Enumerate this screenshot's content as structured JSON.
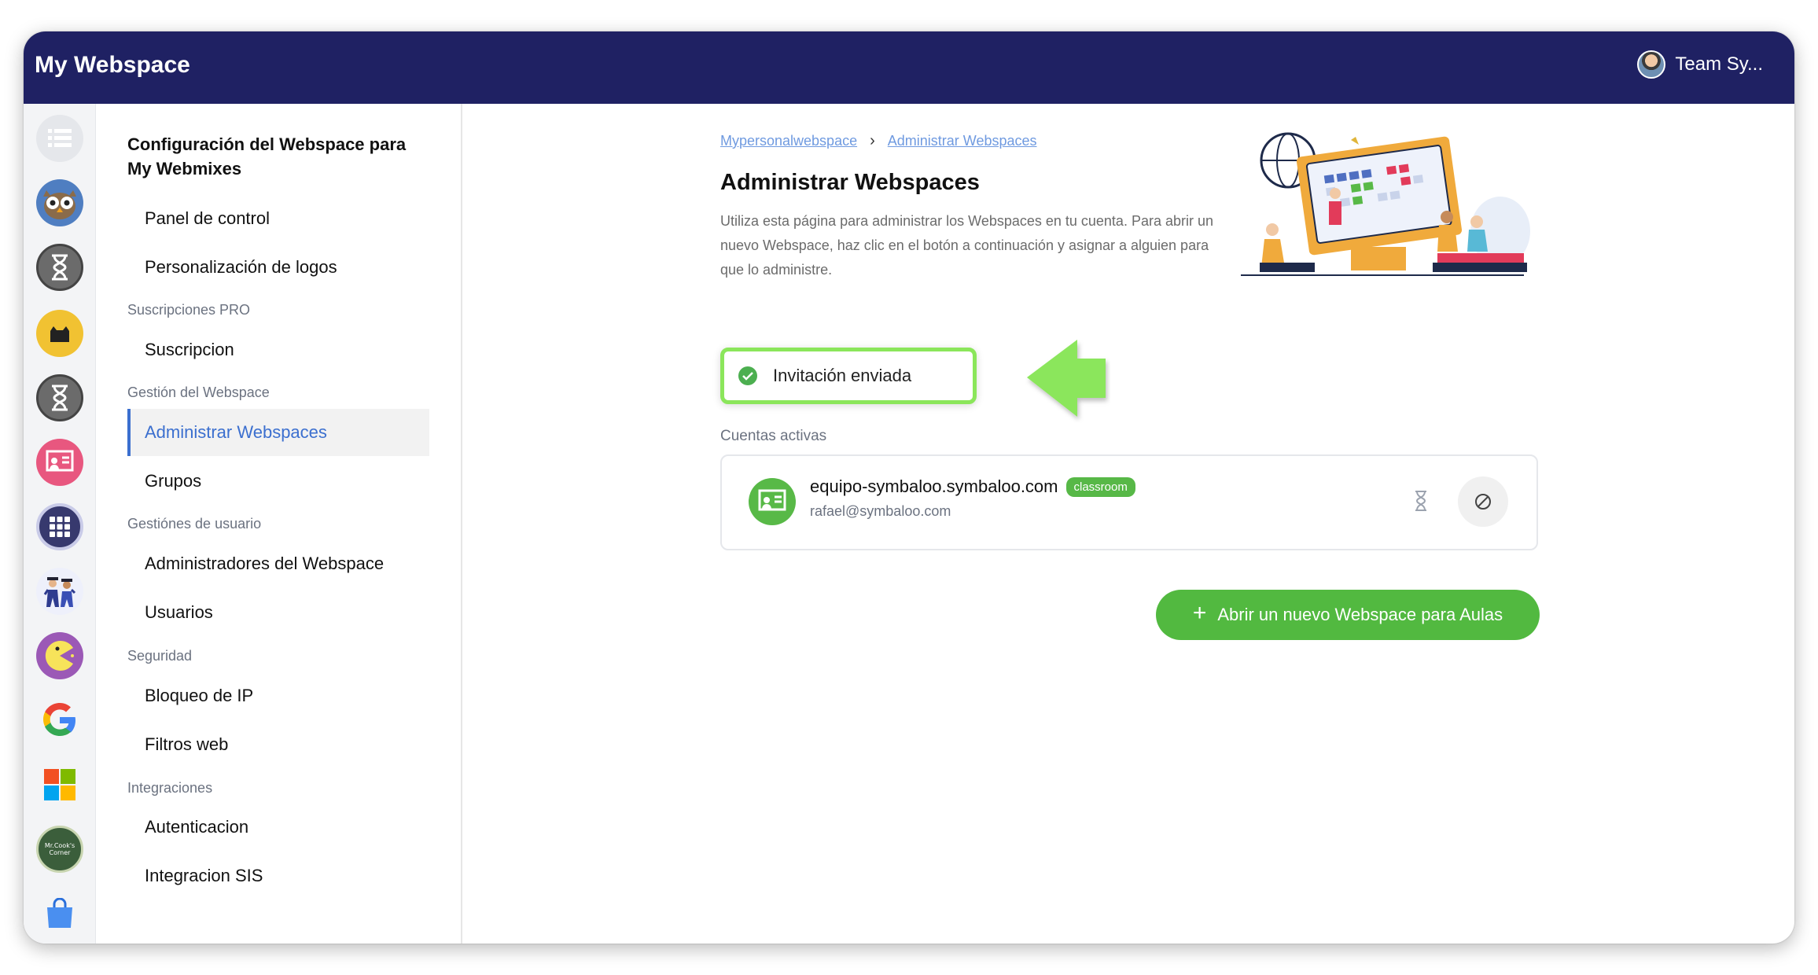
{
  "app": {
    "title": "My Webspace",
    "team_label": "Team Sy..."
  },
  "iconbar": {
    "items": [
      "list-icon",
      "owl-icon",
      "hourglass-icon",
      "cat-icon",
      "hourglass-icon",
      "classroom-icon",
      "apps-grid-icon",
      "graduates-icon",
      "pacman-icon",
      "google-icon",
      "windows-icon",
      "mr-cooks-corner-icon",
      "shopping-bag-icon"
    ],
    "mr_cook_text": "Mr.Cook's Corner"
  },
  "sidebar": {
    "title": "Configuración del Webspace para My Webmixes",
    "items": {
      "panel": "Panel de control",
      "logos": "Personalización de logos",
      "sec_pro": "Suscripciones PRO",
      "suscripcion": "Suscripcion",
      "sec_gestion": "Gestión del Webspace",
      "administrar": "Administrar Webspaces",
      "grupos": "Grupos",
      "sec_usuario": "Gestiónes de usuario",
      "admins": "Administradores del Webspace",
      "usuarios": "Usuarios",
      "sec_seguridad": "Seguridad",
      "bloqueo": "Bloqueo de IP",
      "filtros": "Filtros web",
      "sec_integraciones": "Integraciones",
      "autenticacion": "Autenticacion",
      "sis": "Integracion SIS"
    }
  },
  "main": {
    "breadcrumb": [
      "Mypersonalwebspace",
      "Administrar Webspaces"
    ],
    "title": "Administrar Webspaces",
    "description": "Utiliza esta página para administrar los Webspaces en tu cuenta. Para abrir un nuevo Webspace, haz clic en el botón a continuación y asignar a alguien para que lo administre.",
    "toast": "Invitación enviada",
    "active_accounts_label": "Cuentas activas",
    "account": {
      "domain": "equipo-symbaloo.symbaloo.com",
      "badge": "classroom",
      "email": "rafael@symbaloo.com"
    },
    "new_button": "Abrir un nuevo Webspace para Aulas"
  },
  "colors": {
    "topbar": "#1f2163",
    "accent_blue": "#3b6fcf",
    "green": "#52b940",
    "highlight": "#8be65b"
  }
}
